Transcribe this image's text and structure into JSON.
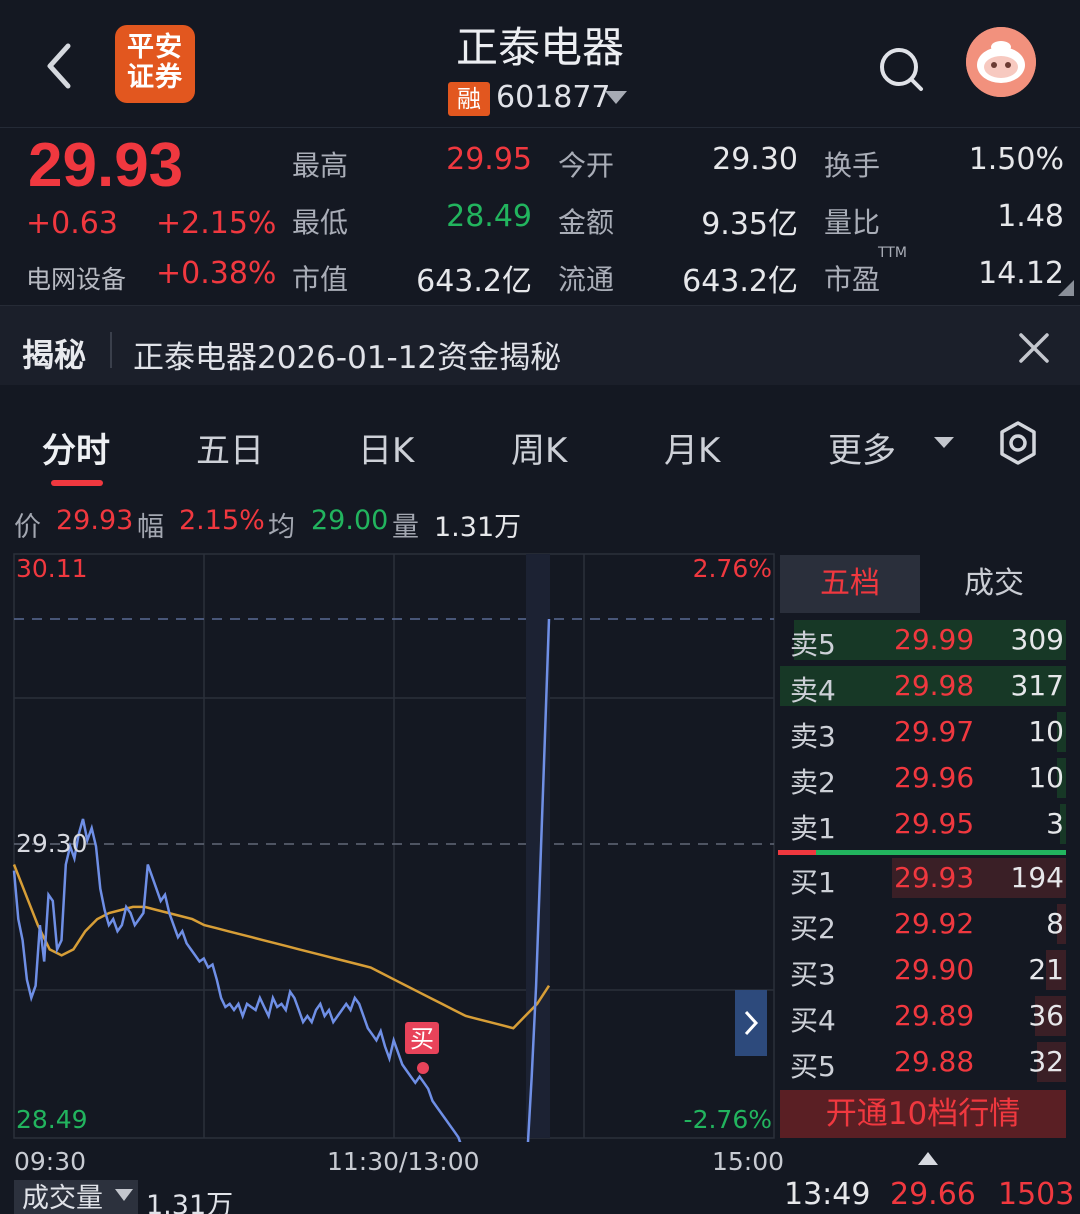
{
  "header": {
    "broker_logo_text": "平安证券",
    "stock_name": "正泰电器",
    "margin_badge": "融",
    "stock_code": "601877"
  },
  "quote": {
    "price": "29.93",
    "change": "+0.63",
    "change_pct": "+2.15%",
    "sector_name": "电网设备",
    "sector_change": "+0.38%",
    "rows": [
      {
        "label1": "最高",
        "value1": "29.95",
        "label2": "今开",
        "value2": "29.30",
        "label3": "换手",
        "value3": "1.50%"
      },
      {
        "label1": "最低",
        "value1": "28.49",
        "label2": "金额",
        "value2": "9.35亿",
        "label3": "量比",
        "value3": "1.48"
      },
      {
        "label1": "市值",
        "value1": "643.2亿",
        "label2": "流通",
        "value2": "643.2亿",
        "label3": "市盈",
        "value3": "14.12"
      }
    ],
    "ttm_label": "TTM"
  },
  "reveal": {
    "tag": "揭秘",
    "text": "正泰电器2026-01-12资金揭秘"
  },
  "tabs": [
    "分时",
    "五日",
    "日K",
    "周K",
    "月K",
    "更多"
  ],
  "info": {
    "price_label": "价",
    "price_value": "29.93",
    "amp_label": "幅",
    "amp_value": "2.15%",
    "avg_label": "均",
    "avg_value": "29.00",
    "vol_label": "量",
    "vol_value": "1.31万"
  },
  "chart_labels": {
    "y_top": "30.11",
    "y_mid": "29.30",
    "y_bottom": "28.49",
    "pct_top": "2.76%",
    "pct_bottom": "-2.76%",
    "buy_marker": "买",
    "time_start": "09:30",
    "time_mid": "11:30/13:00",
    "time_end": "15:00"
  },
  "chart_data": {
    "type": "line",
    "ylim": [
      28.49,
      30.11
    ],
    "prev_close": 29.3,
    "x_range_minutes": [
      0,
      240
    ],
    "series": [
      {
        "values": [
          29.28,
          29.12,
          29.05,
          28.92,
          28.86,
          28.9,
          29.1,
          28.98,
          29.2,
          29.18,
          29.02,
          29.05,
          29.3,
          29.36,
          29.32,
          29.4,
          29.45,
          29.38,
          29.42,
          29.36,
          29.22,
          29.15,
          29.1,
          29.12,
          29.08,
          29.1,
          29.16,
          29.14,
          29.1,
          29.12,
          29.14,
          29.3,
          29.26,
          29.22,
          29.18,
          29.2,
          29.14,
          29.1,
          29.06,
          29.08,
          29.04,
          29.02,
          29.0,
          28.98,
          28.99,
          28.96,
          28.97,
          28.92,
          28.86,
          28.83,
          28.84,
          28.82,
          28.84,
          28.8,
          28.84,
          28.83,
          28.82,
          28.86,
          28.83,
          28.8,
          28.86,
          28.83,
          28.84,
          28.82,
          28.88,
          28.86,
          28.82,
          28.78,
          28.8,
          28.78,
          28.82,
          28.84,
          28.8,
          28.82,
          28.78,
          28.8,
          28.82,
          28.84,
          28.82,
          28.86,
          28.84,
          28.8,
          28.76,
          28.74,
          28.72,
          28.75,
          28.7,
          28.66,
          28.72,
          28.68,
          28.64,
          28.62,
          28.6,
          28.58,
          28.6,
          28.58,
          28.56,
          28.52,
          28.5,
          28.48,
          28.46,
          28.44,
          28.42,
          28.4,
          28.36,
          28.34,
          28.32,
          28.3,
          28.28,
          28.26,
          28.24,
          28.22,
          28.2,
          28.18,
          28.16,
          28.14,
          28.12,
          28.12,
          28.2,
          28.35,
          28.6,
          28.9,
          29.3,
          29.7,
          30.11
        ]
      },
      {
        "values": [
          29.3,
          29.2,
          29.1,
          29.02,
          29.0,
          29.02,
          29.08,
          29.12,
          29.14,
          29.15,
          29.16,
          29.16,
          29.15,
          29.14,
          29.13,
          29.12,
          29.1,
          29.09,
          29.08,
          29.07,
          29.06,
          29.05,
          29.04,
          29.03,
          29.02,
          29.01,
          29.0,
          28.99,
          28.98,
          28.97,
          28.96,
          28.94,
          28.92,
          28.9,
          28.88,
          28.86,
          28.84,
          28.82,
          28.8,
          28.79,
          28.78,
          28.77,
          28.76,
          28.8,
          28.84,
          28.9
        ]
      }
    ]
  },
  "order_book": {
    "tab_five": "五档",
    "tab_trade": "成交",
    "asks": [
      {
        "label": "卖5",
        "price": "29.99",
        "volume": "309",
        "depth": 0.95
      },
      {
        "label": "卖4",
        "price": "29.98",
        "volume": "317",
        "depth": 1.0
      },
      {
        "label": "卖3",
        "price": "29.97",
        "volume": "10",
        "depth": 0.03
      },
      {
        "label": "卖2",
        "price": "29.96",
        "volume": "10",
        "depth": 0.03
      },
      {
        "label": "卖1",
        "price": "29.95",
        "volume": "3",
        "depth": 0.01
      }
    ],
    "bids": [
      {
        "label": "买1",
        "price": "29.93",
        "volume": "194",
        "depth": 0.61
      },
      {
        "label": "买2",
        "price": "29.92",
        "volume": "8",
        "depth": 0.03
      },
      {
        "label": "买3",
        "price": "29.90",
        "volume": "21",
        "depth": 0.07
      },
      {
        "label": "买4",
        "price": "29.89",
        "volume": "36",
        "depth": 0.11
      },
      {
        "label": "买5",
        "price": "29.88",
        "volume": "32",
        "depth": 0.1
      }
    ],
    "upgrade_text": "开通10档行情"
  },
  "bottom": {
    "vol_tab": "成交量",
    "vol_value": "1.31万",
    "last_tick_time": "13:49",
    "last_tick_price": "29.66",
    "last_tick_volume": "1503"
  }
}
